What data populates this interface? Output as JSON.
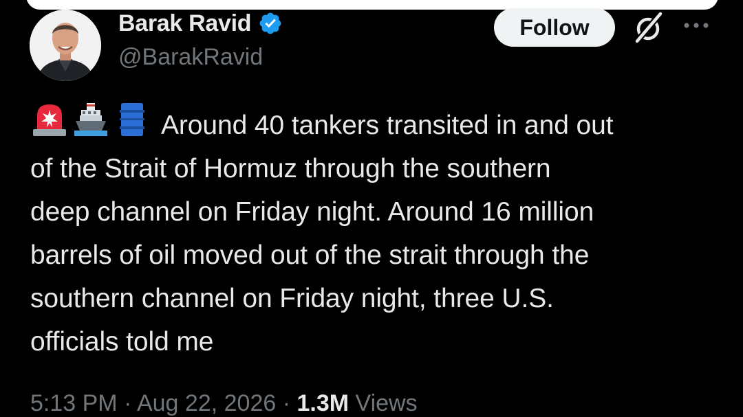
{
  "author": {
    "display_name": "Barak Ravid",
    "handle": "@BarakRavid",
    "verified": true
  },
  "actions": {
    "follow_label": "Follow",
    "grok_icon": "grok-icon",
    "more_icon": "more-dots-icon"
  },
  "tweet": {
    "emojis": [
      "police-light-emoji",
      "ship-emoji",
      "oil-drum-emoji"
    ],
    "text": "Around 40 tankers transited in and out\nof the Strait of Hormuz through the southern\ndeep channel on Friday night. Around 16 million\nbarrels of oil moved out of the strait through the\nsouthern channel on Friday night, three U.S.\nofficials told me"
  },
  "meta": {
    "time": "5:13 PM",
    "separator": " · ",
    "date": "Aug 22, 2026",
    "views_count": "1.3M",
    "views_label": "Views"
  },
  "colors": {
    "background": "#000000",
    "text_primary": "#e7e9ea",
    "text_secondary": "#71767b",
    "verified_blue": "#1d9bf0",
    "follow_bg": "#eff3f4"
  }
}
